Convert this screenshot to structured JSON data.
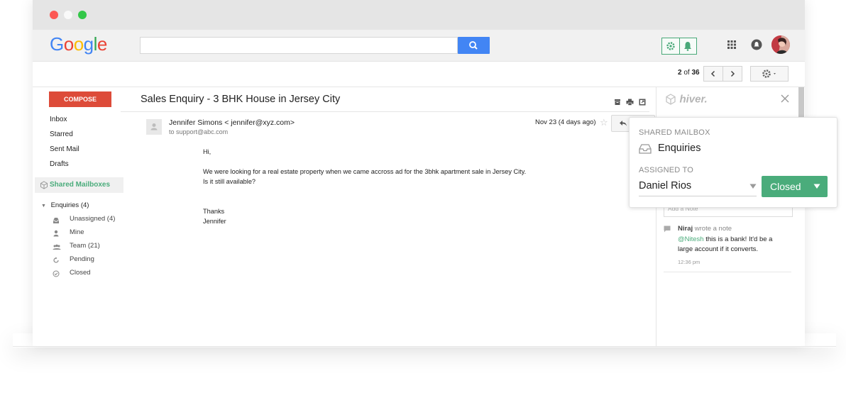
{
  "window": {
    "controls": [
      "close",
      "minimize",
      "maximize"
    ]
  },
  "header": {
    "logo": "Google",
    "search": {
      "value": "",
      "placeholder": "",
      "icon": "search-icon"
    },
    "hiver_buttons": [
      "gear-icon",
      "bell-icon"
    ],
    "apps_icon": "grid-icon",
    "notifications_icon": "bell-icon"
  },
  "toolbar": {
    "pager_current": "2",
    "pager_of": "of",
    "pager_total": "36"
  },
  "sidebar": {
    "compose": "COMPOSE",
    "nav": [
      "Inbox",
      "Starred",
      "Sent Mail",
      "Drafts"
    ],
    "shared_mailboxes": "Shared Mailboxes",
    "group": "Enquiries (4)",
    "subitems": [
      {
        "label": "Unassigned (4)",
        "icon": "inbox-icon"
      },
      {
        "label": "Mine",
        "icon": "person-icon"
      },
      {
        "label": "Team (21)",
        "icon": "team-icon"
      },
      {
        "label": "Pending",
        "icon": "pending-icon"
      },
      {
        "label": "Closed",
        "icon": "check-icon"
      }
    ]
  },
  "mail": {
    "subject": "Sales Enquiry - 3 BHK House in Jersey City",
    "from": "Jennifer Simons < jennifer@xyz.com>",
    "to": "to support@abc.com",
    "date": "Nov 23 (4 days ago)",
    "body": {
      "greeting": "Hi,",
      "line1": "We were looking for a real estate property when we came accross ad for the 3bhk apartment sale in Jersey City.",
      "line2": "Is it still available?",
      "sign1": "Thanks",
      "sign2": "Jennifer"
    }
  },
  "hiver_panel": {
    "brand": "hiver.",
    "note_placeholder": "Add a Note",
    "note_author": "Niraj",
    "note_action": "wrote a note",
    "note_mention": "@Nitesh",
    "note_text_rest": "this is a bank! It'd be a",
    "note_text_line2": "large account if it converts.",
    "note_time": "12:36 pm"
  },
  "popup": {
    "shared_mailbox_label": "SHARED MAILBOX",
    "mailbox": "Enquiries",
    "assigned_label": "ASSIGNED TO",
    "assignee": "Daniel Rios",
    "status": "Closed"
  },
  "colors": {
    "accent_green": "#4aac7b",
    "compose_red": "#dd4b39",
    "search_blue": "#4285f4"
  }
}
